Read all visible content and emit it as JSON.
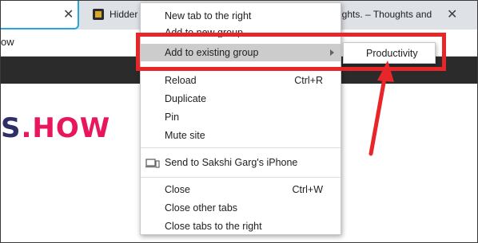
{
  "tabs": [
    {
      "title": "",
      "close_icon": "✕"
    },
    {
      "title": "Hidder",
      "close_icon": "✕"
    },
    {
      "title": "ughts. – Thoughts and",
      "close_icon": "✕"
    }
  ],
  "bookmarks_bar": {
    "text": "ow"
  },
  "page": {
    "logo_left": "S",
    "logo_right": ".HOW"
  },
  "context_menu": {
    "items": [
      {
        "label": "New tab to the right",
        "shortcut": ""
      },
      {
        "label": "Add to new group",
        "shortcut": ""
      },
      {
        "label": "Add to existing group",
        "shortcut": "",
        "submenu": true,
        "highlighted": true
      },
      {
        "label": "Reload",
        "shortcut": "Ctrl+R"
      },
      {
        "label": "Duplicate",
        "shortcut": ""
      },
      {
        "label": "Pin",
        "shortcut": ""
      },
      {
        "label": "Mute site",
        "shortcut": ""
      },
      {
        "label": "Send to Sakshi Garg's iPhone",
        "shortcut": "",
        "icon": "device-icon"
      },
      {
        "label": "Close",
        "shortcut": "Ctrl+W"
      },
      {
        "label": "Close other tabs",
        "shortcut": ""
      },
      {
        "label": "Close tabs to the right",
        "shortcut": ""
      }
    ]
  },
  "submenu": {
    "items": [
      {
        "label": "Productivity"
      }
    ]
  },
  "colors": {
    "annotation": "#e8262a",
    "active_tab_border": "#27a7d8",
    "logo_dark": "#2d2f66",
    "logo_accent": "#e8175d",
    "menu_highlight": "#cccccc"
  }
}
